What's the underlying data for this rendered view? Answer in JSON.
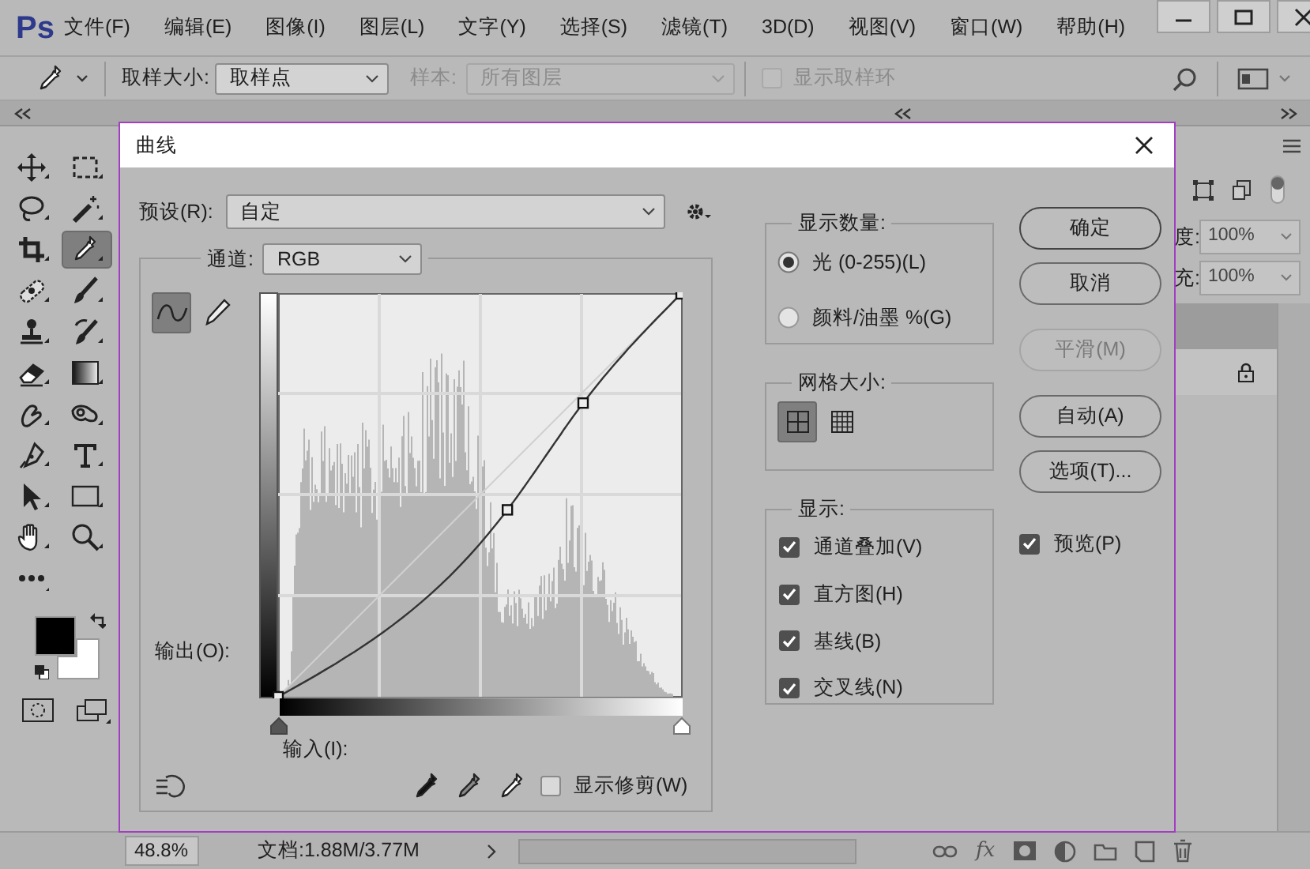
{
  "app_logo": "Ps",
  "menu": [
    "文件(F)",
    "编辑(E)",
    "图像(I)",
    "图层(L)",
    "文字(Y)",
    "选择(S)",
    "滤镜(T)",
    "3D(D)",
    "视图(V)",
    "窗口(W)",
    "帮助(H)"
  ],
  "options_bar": {
    "sample_size_label": "取样大小:",
    "sample_size_value": "取样点",
    "sample_label": "样本:",
    "sample_value": "所有图层",
    "sample_disabled": true,
    "ring": {
      "label": "显示取样环",
      "checked": false,
      "disabled": true
    }
  },
  "tools": [
    {
      "kind": "move",
      "selected": false
    },
    {
      "kind": "marquee",
      "selected": false
    },
    {
      "kind": "lasso",
      "selected": false
    },
    {
      "kind": "magic-wand",
      "selected": false
    },
    {
      "kind": "crop",
      "selected": false
    },
    {
      "kind": "eyedropper",
      "selected": true
    },
    {
      "kind": "healing",
      "selected": false
    },
    {
      "kind": "brush",
      "selected": false
    },
    {
      "kind": "stamp",
      "selected": false
    },
    {
      "kind": "history-brush",
      "selected": false
    },
    {
      "kind": "eraser",
      "selected": false
    },
    {
      "kind": "gradient",
      "selected": false
    },
    {
      "kind": "smudge",
      "selected": false
    },
    {
      "kind": "sponge",
      "selected": false
    },
    {
      "kind": "pen",
      "selected": false
    },
    {
      "kind": "type",
      "selected": false
    },
    {
      "kind": "path-select",
      "selected": false
    },
    {
      "kind": "rectangle",
      "selected": false
    },
    {
      "kind": "hand",
      "selected": false
    },
    {
      "kind": "zoom",
      "selected": false
    },
    {
      "kind": "more",
      "selected": false
    }
  ],
  "swatches": [
    {
      "kind": "foreground",
      "color": "#000000"
    },
    {
      "kind": "background",
      "color": "#ffffff"
    }
  ],
  "dialog": {
    "title": "曲线",
    "preset_label": "预设(R):",
    "preset_value": "自定",
    "channel_label": "通道:",
    "channel_value": "RGB",
    "curve_tools": [
      {
        "kind": "curve",
        "selected": true
      },
      {
        "kind": "pencil",
        "selected": false
      }
    ],
    "output_label": "输出(O):",
    "input_label": "输入(I):",
    "input_sliders": [
      {
        "kind": "shadow",
        "level": 0
      },
      {
        "kind": "highlight",
        "level": 1
      }
    ],
    "show_clipping": {
      "label": "显示修剪(W)",
      "checked": false
    },
    "display_amount": {
      "title": "显示数量:",
      "options": [
        {
          "label": "光 (0-255)(L)",
          "selected": true
        },
        {
          "label": "颜料/油墨 %(G)",
          "selected": false
        }
      ]
    },
    "grid_size": {
      "title": "网格大小:",
      "options": [
        {
          "kind": "simple",
          "selected": true
        },
        {
          "kind": "detailed",
          "selected": false
        }
      ]
    },
    "show": {
      "title": "显示:",
      "options": [
        {
          "label": "通道叠加(V)",
          "checked": true
        },
        {
          "label": "直方图(H)",
          "checked": true
        },
        {
          "label": "基线(B)",
          "checked": true
        },
        {
          "label": "交叉线(N)",
          "checked": true
        }
      ]
    },
    "buttons": [
      {
        "label": "确定",
        "disabled": false
      },
      {
        "label": "取消",
        "disabled": false
      },
      {
        "label": "平滑(M)",
        "disabled": true
      },
      {
        "label": "自动(A)",
        "disabled": false
      },
      {
        "label": "选项(T)...",
        "disabled": false
      }
    ],
    "preview": {
      "label": "预览(P)",
      "checked": true
    }
  },
  "layers_panel": {
    "opacity_label": "度:",
    "opacity_value": "100%",
    "fill_label": "充:",
    "fill_value": "100%",
    "layers": [
      {
        "selected": true,
        "locked": false
      },
      {
        "selected": false,
        "locked": true
      }
    ],
    "footer_fx": "fx"
  },
  "status_bar": {
    "zoom": "48.8%",
    "document": "文档:1.88M/3.77M"
  }
}
